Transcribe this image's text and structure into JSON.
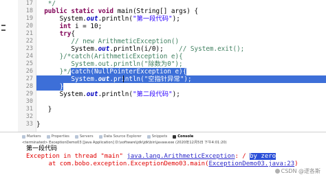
{
  "gutter": {
    "line_numbers": [
      "17",
      "18",
      "19",
      "20",
      "21",
      "22",
      "23",
      "24",
      "25",
      "26",
      "27",
      "28",
      "29",
      "30",
      "31",
      "32",
      "33"
    ]
  },
  "code": {
    "l17": "   */",
    "l18_kw1": "public static void ",
    "l18_rest": "main(String[] args) {",
    "l19_a": "      System.",
    "l19_out": "out",
    "l19_b": ".println(",
    "l19_str": "\"第一段代码\"",
    "l19_c": ");",
    "l20_kw": "      int ",
    "l20_rest": "i = 10;",
    "l21_kw": "      try",
    "l21_rest": "{",
    "l22": "         // new ArithmeticException()",
    "l23_a": "         System.",
    "l23_out": "out",
    "l23_b": ".println(i/0);    ",
    "l23_cmt": "// System.exit();",
    "l24": "      }/*catch(ArithmeticException e){",
    "l25_a": "         System.",
    "l25_out": "out",
    "l25_b": ".println(\"除数为0\");",
    "l26_pre": "      }*/",
    "l26_sel": "catch(NullPointerException e){",
    "l27_a": "         System.",
    "l27_out": "out",
    "l27_b": ".println(",
    "l27_str": "\"空指针异常\"",
    "l27_c": ");",
    "l28_sel": "      }",
    "l29_a": "      System.",
    "l29_out": "out",
    "l29_b": ".println(",
    "l29_str": "\"第二段代码\"",
    "l29_c": ");",
    "l31": "   }",
    "l33": "}"
  },
  "console": {
    "tabs": [
      "Markers",
      "Properties",
      "Servers",
      "Data Source Explorer",
      "Snippets",
      "Console"
    ],
    "terminated": "<terminated> ExceptionDemo03 [Java Application] D:\\software\\jdk\\jdk\\bin\\javaw.exe (2020年12月5日 下午4:01:20)",
    "out1": "第一段代码",
    "err_prefix": "Exception in thread \"main\" ",
    "err_exc": "java.lang.ArithmeticException",
    "err_mid": ": / ",
    "err_hl": "by zero",
    "at_prefix": "      at com.bobo.exception.ExceptionDemo03.main(",
    "at_link": "ExceptionDemo03.java:23",
    "at_suffix": ")"
  },
  "watermark": "CSDN @逻各斯"
}
